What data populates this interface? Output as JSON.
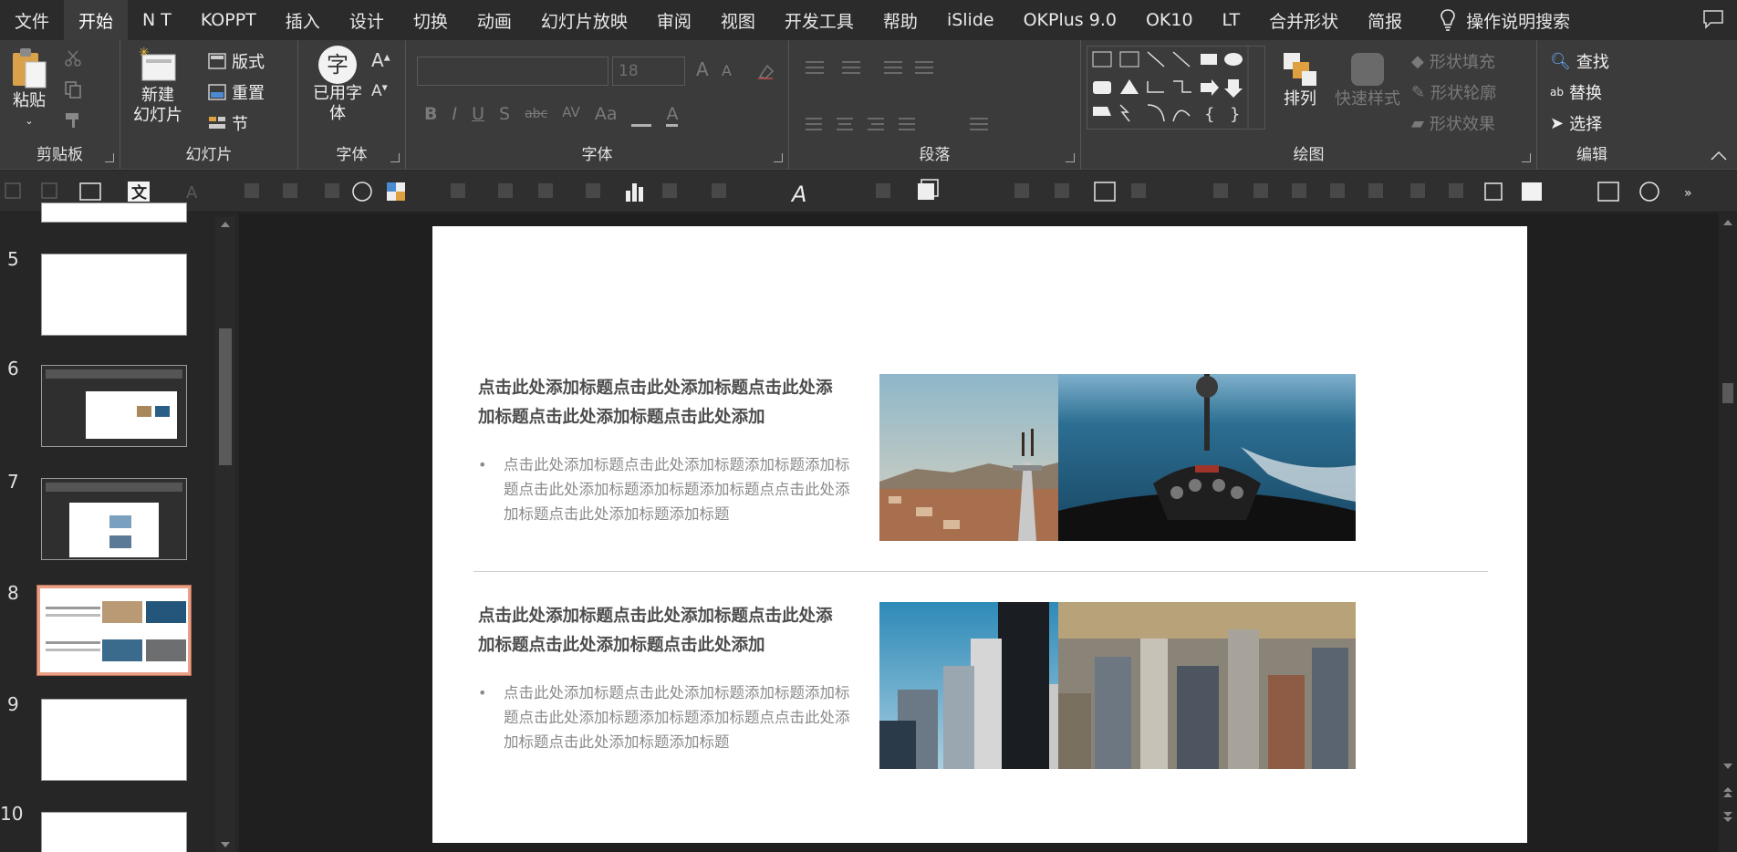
{
  "menubar": {
    "items": [
      "文件",
      "开始",
      "N T",
      "KOPPT",
      "插入",
      "设计",
      "切换",
      "动画",
      "幻灯片放映",
      "审阅",
      "视图",
      "开发工具",
      "帮助",
      "iSlide",
      "OKPlus 9.0",
      "OK10",
      "LT",
      "合并形状",
      "简报"
    ],
    "search_label": "操作说明搜索"
  },
  "ribbon": {
    "clipboard": {
      "paste": "粘贴",
      "label": "剪贴板"
    },
    "slides": {
      "new_slide_line1": "新建",
      "new_slide_line2": "幻灯片",
      "layout": "版式",
      "reset": "重置",
      "section": "节",
      "label": "幻灯片"
    },
    "used_fonts": {
      "line1": "已用字",
      "line2": "体",
      "glyph": "字",
      "label": "字体"
    },
    "font": {
      "size": "18",
      "label": "字体",
      "bold": "B",
      "italic": "I",
      "underline": "U",
      "shadow": "S",
      "strike": "abc",
      "spacing": "AV",
      "case": "Aa"
    },
    "paragraph": {
      "label": "段落"
    },
    "drawing": {
      "arrange": "排列",
      "quick_styles": "快速样式",
      "shape_fill": "形状填充",
      "shape_outline": "形状轮廓",
      "shape_effects": "形状效果",
      "label": "绘图",
      "brace_left": "{",
      "brace_right": "}"
    },
    "editing": {
      "find": "查找",
      "replace": "替换",
      "select": "选择",
      "label": "编辑"
    }
  },
  "thumbnails": {
    "numbers": [
      "5",
      "6",
      "7",
      "8",
      "9",
      "10"
    ],
    "selected": "8"
  },
  "slide": {
    "blocks": [
      {
        "title": "点击此处添加标题点击此处添加标题点击此处添加标题点击此处添加标题点击此处添加",
        "body": "点击此处添加标题点击此处添加标题添加标题添加标题点击此处添加标题添加标题添加标题点点击此处添加标题点击此处添加标题添加标题"
      },
      {
        "title": "点击此处添加标题点击此处添加标题点击此处添加标题点击此处添加标题点击此处添加",
        "body": "点击此处添加标题点击此处添加标题添加标题添加标题点击此处添加标题添加标题添加标题点点击此处添加标题点击此处添加标题添加标题"
      }
    ],
    "bullet": "•",
    "photos": [
      "city-tower-climbers-photo",
      "helicopter-cockpit-coast-photo",
      "skyscrapers-blue-sky-photo",
      "city-aerial-photo"
    ]
  },
  "colors": {
    "accent_selected": "#e8a186",
    "ribbon_bg": "#3b3b3b",
    "menubar_bg": "#2b2b2b"
  }
}
